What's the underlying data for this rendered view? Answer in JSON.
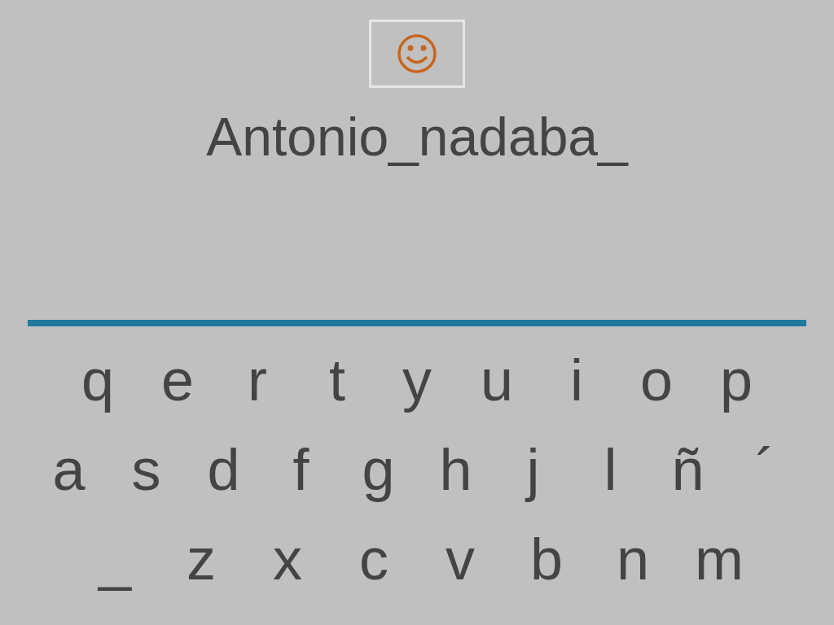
{
  "answer": {
    "text": "Antonio_nadaba_"
  },
  "keyboard": {
    "rows": [
      [
        "q",
        "e",
        "r",
        "t",
        "y",
        "u",
        "i",
        "o",
        "p"
      ],
      [
        "a",
        "s",
        "d",
        "f",
        "g",
        "h",
        "j",
        "l",
        "ñ",
        "´"
      ],
      [
        "_",
        "z",
        "x",
        "c",
        "v",
        "b",
        "n",
        "m"
      ]
    ]
  }
}
